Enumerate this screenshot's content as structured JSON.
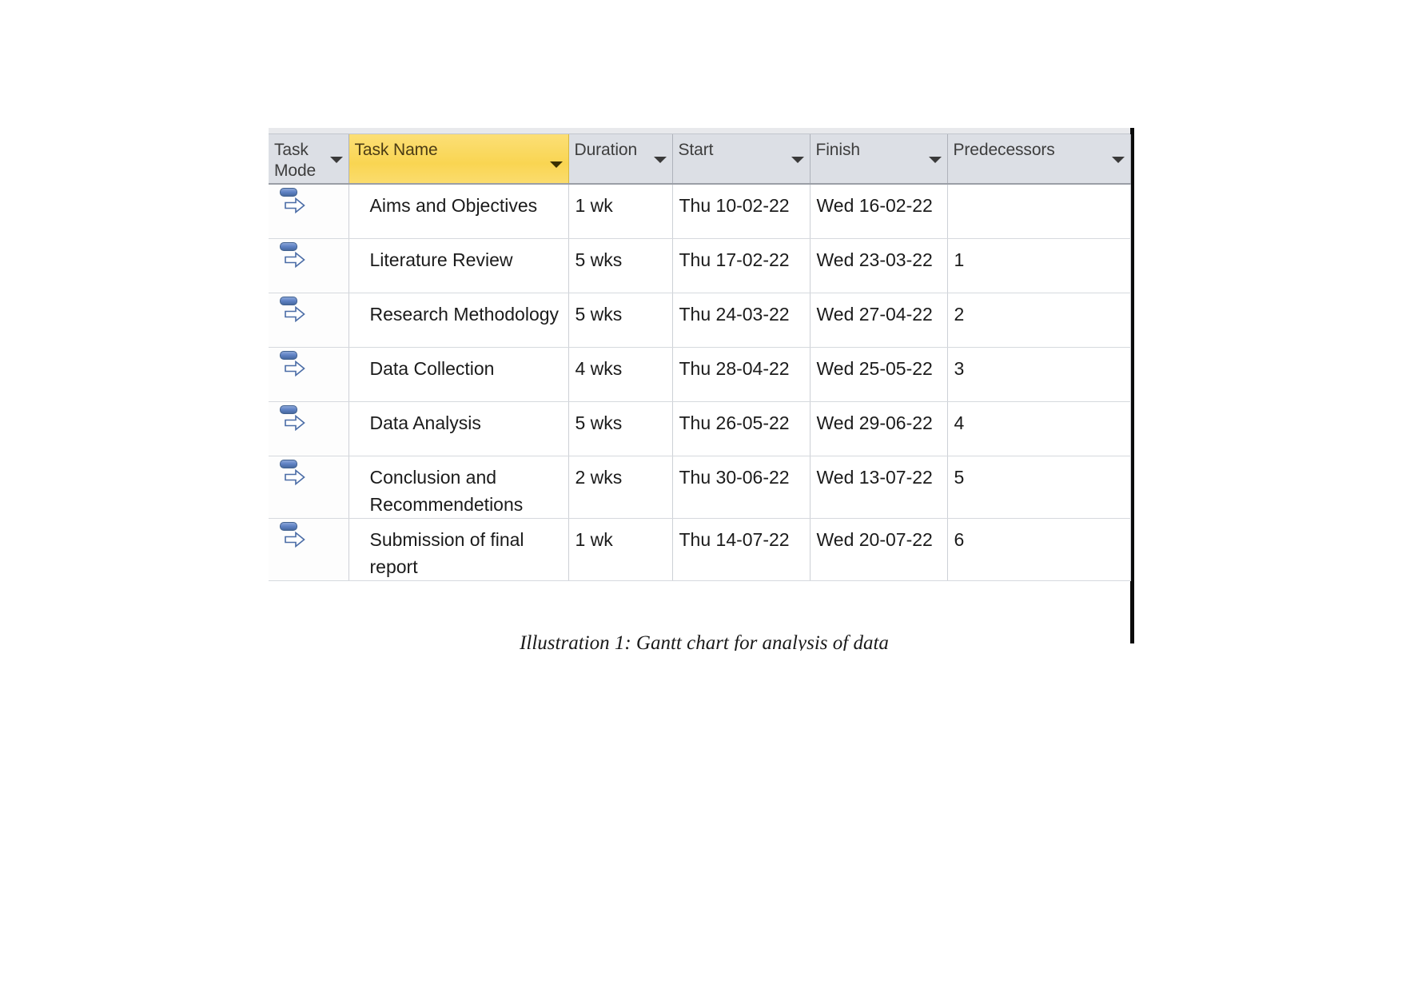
{
  "figure": {
    "caption": "Illustration 1: Gantt chart for analysis of data",
    "colors": {
      "header_background": "#dcdfe5",
      "header_highlight": "#fad85f",
      "grid_line": "#cdd0d6",
      "split_bar": "#0b0b0b",
      "icon_blue": "#5f82c4",
      "text": "#1b1b1b"
    }
  },
  "table": {
    "columns": [
      {
        "key": "task_mode",
        "label": "Task\nMode",
        "highlight": false
      },
      {
        "key": "task_name",
        "label": "Task Name",
        "highlight": true
      },
      {
        "key": "duration",
        "label": "Duration",
        "highlight": false
      },
      {
        "key": "start",
        "label": "Start",
        "highlight": false
      },
      {
        "key": "finish",
        "label": "Finish",
        "highlight": false
      },
      {
        "key": "predecessors",
        "label": "Predecessors",
        "highlight": false
      }
    ],
    "rows": [
      {
        "task_mode_icon": "auto-scheduled-icon",
        "task_name": "Aims and Objectives",
        "duration": "1 wk",
        "start": "Thu 10-02-22",
        "finish": "Wed 16-02-22",
        "predecessors": ""
      },
      {
        "task_mode_icon": "auto-scheduled-icon",
        "task_name": "Literature Review",
        "duration": "5 wks",
        "start": "Thu 17-02-22",
        "finish": "Wed 23-03-22",
        "predecessors": "1"
      },
      {
        "task_mode_icon": "auto-scheduled-icon",
        "task_name": "Research Methodology",
        "duration": "5 wks",
        "start": "Thu 24-03-22",
        "finish": "Wed 27-04-22",
        "predecessors": "2"
      },
      {
        "task_mode_icon": "auto-scheduled-icon",
        "task_name": "Data Collection",
        "duration": "4 wks",
        "start": "Thu 28-04-22",
        "finish": "Wed 25-05-22",
        "predecessors": "3"
      },
      {
        "task_mode_icon": "auto-scheduled-icon",
        "task_name": "Data Analysis",
        "duration": "5 wks",
        "start": "Thu 26-05-22",
        "finish": "Wed 29-06-22",
        "predecessors": "4"
      },
      {
        "task_mode_icon": "auto-scheduled-icon",
        "task_name": "Conclusion and\nRecommendetions",
        "duration": "2 wks",
        "start": "Thu 30-06-22",
        "finish": "Wed 13-07-22",
        "predecessors": "5"
      },
      {
        "task_mode_icon": "auto-scheduled-icon",
        "task_name": "Submission of final\nreport",
        "duration": "1 wk",
        "start": "Thu 14-07-22",
        "finish": "Wed 20-07-22",
        "predecessors": "6"
      }
    ]
  }
}
